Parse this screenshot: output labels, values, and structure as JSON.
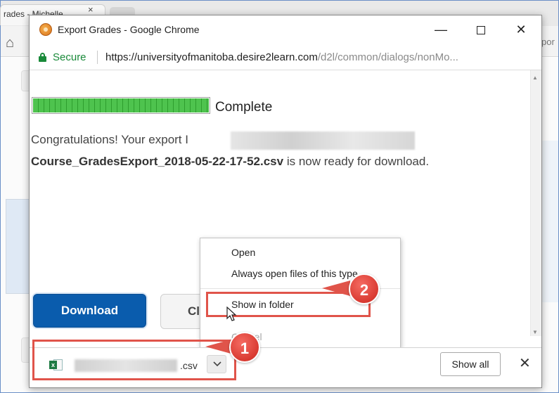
{
  "background_browser": {
    "tab_title": "rades - Michelle",
    "tab_close": "×",
    "url_fragment": "por"
  },
  "popup": {
    "title": "Export Grades - Google Chrome",
    "controls": {
      "minimize": "—",
      "maximize": "",
      "close": "✕"
    },
    "address": {
      "secure_label": "Secure",
      "url_host": "https://universityofmanitoba.desire2learn.com",
      "url_path": "/d2l/common/dialogs/nonMo..."
    },
    "progress": {
      "value": 1.0,
      "label": "Complete"
    },
    "message": {
      "line1_prefix": "Congratulations! Your export I",
      "filename": "Course_GradesExport_2018-05-22-17-52.csv",
      "line2_suffix": " is now ready for download."
    },
    "buttons": {
      "download": "Download",
      "close": "Close"
    }
  },
  "context_menu": {
    "items": [
      {
        "label": "Open"
      },
      {
        "label": "Always open files of this type"
      },
      {
        "label": "Show in folder"
      },
      {
        "label": "Cancel"
      }
    ]
  },
  "download_shelf": {
    "file_ext": ".csv",
    "show_all": "Show all",
    "close": "✕"
  },
  "callouts": {
    "one": "1",
    "two": "2"
  },
  "colors": {
    "callout_red": "#e0544a",
    "secure_green": "#1a8a3a",
    "download_blue": "#0a5cad"
  }
}
